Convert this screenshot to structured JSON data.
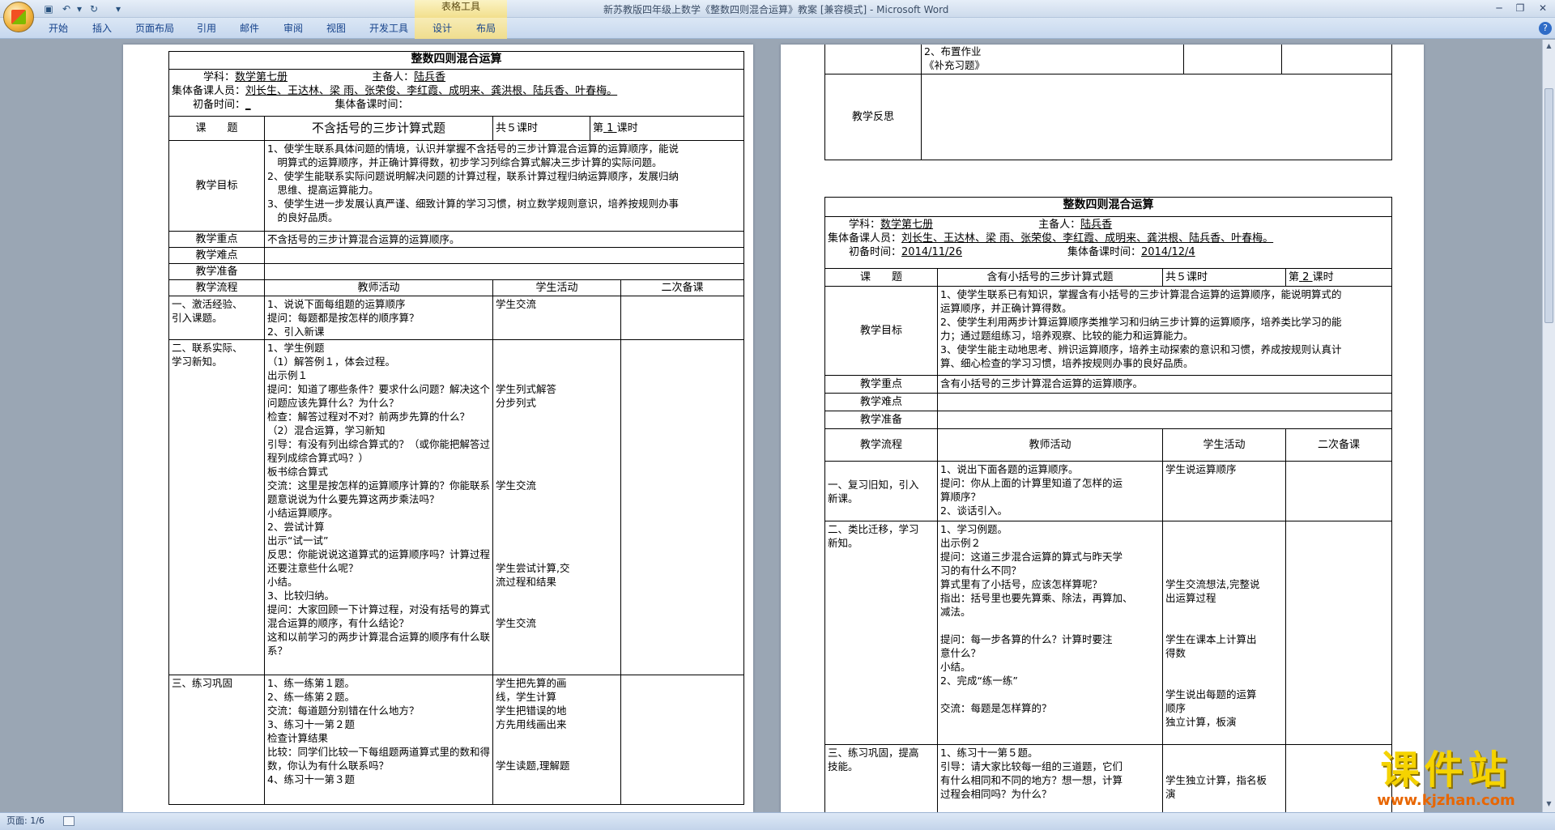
{
  "window": {
    "title": "新苏教版四年级上数学《整数四则混合运算》教案 [兼容模式] - Microsoft Word",
    "context_group": "表格工具"
  },
  "ribbon": {
    "tabs": [
      "开始",
      "插入",
      "页面布局",
      "引用",
      "邮件",
      "审阅",
      "视图",
      "开发工具",
      "设计",
      "布局"
    ]
  },
  "status": {
    "page": "页面: 1/6"
  },
  "left_page": {
    "title": "整数四则混合运算",
    "subject_label": "学科：",
    "subject": "数学第七册",
    "preparer_label": "主备人：",
    "preparer": "陆兵香",
    "members_label": "集体备课人员：",
    "members": "刘长生、王达林、梁 雨、张荣俊、李红霞、成明来、龚洪根、陆兵香、叶春梅。",
    "prep_time_label": "初备时间：",
    "prep_time": "_",
    "group_time_label": "集体备课时间：",
    "topic_label": "课　　题",
    "topic": "不含括号的三步计算式题",
    "total_hours": "共５课时",
    "nth_prefix": "第",
    "nth_value": "1",
    "nth_suffix": "课时",
    "goals_label": "教学目标",
    "goals": [
      "1、使学生联系具体问题的情境，认识并掌握不含括号的三步计算混合运算的运算顺序，能说",
      "　明算式的运算顺序，并正确计算得数，初步学习列综合算式解决三步计算的实际问题。",
      "2、使学生能联系实际问题说明解决问题的计算过程，联系计算过程归纳运算顺序，发展归纳",
      "　思维、提高运算能力。",
      "3、使学生进一步发展认真严谨、细致计算的学习习惯，树立数学规则意识，培养按规则办事",
      "　的良好品质。"
    ],
    "key_label": "教学重点",
    "key": "不含括号的三步计算混合运算的运算顺序。",
    "difficulty_label": "教学难点",
    "prep_label": "教学准备",
    "flow_head": [
      "教学流程",
      "教师活动",
      "学生活动",
      "二次备课"
    ],
    "sections": [
      {
        "name": [
          "一、激活经验、",
          "引入课题。"
        ],
        "teacher": [
          "1、说说下面每组题的运算顺序",
          "提问：每题都是按怎样的顺序算？",
          "2、引入新课"
        ],
        "student": [
          "学生交流"
        ]
      },
      {
        "name": [
          "二、联系实际、",
          "学习新知。"
        ],
        "teacher": [
          "1、学生例题",
          "（1）解答例１，体会过程。",
          "出示例１",
          "提问：知道了哪些条件？要求什么问题？解决这个",
          "问题应该先算什么？为什么？",
          "检查：解答过程对不对？前两步先算的什么？",
          "（2）混合运算，学习新知",
          "引导：有没有列出综合算式的？（或你能把解答过",
          "程列成综合算式吗？）",
          "板书综合算式",
          "交流：这里是按怎样的运算顺序计算的？你能联系",
          "题意说说为什么要先算这两步乘法吗？",
          "小结运算顺序。",
          "2、尝试计算",
          "出示“试一试”",
          "反思：你能说说这道算式的运算顺序吗？计算过程",
          "还要注意些什么呢？",
          "小结。",
          "3、比较归纳。",
          "提问：大家回顾一下计算过程，对没有括号的算式",
          "混合运算的顺序，有什么结论？",
          "这和以前学习的两步计算混合运算的顺序有什么联",
          "系？"
        ],
        "student": [
          "",
          "",
          "",
          "学生列式解答",
          "分步列式",
          "",
          "",
          "",
          "",
          "",
          "学生交流",
          "",
          "",
          "",
          "",
          "",
          "学生尝试计算,交",
          "流过程和结果",
          "",
          "",
          "学生交流"
        ]
      },
      {
        "name": [
          "三、练习巩固"
        ],
        "teacher": [
          "1、练一练第１题。",
          "2、练一练第２题。",
          "交流：每道题分别错在什么地方？",
          "3、练习十一第２题",
          "检查计算结果",
          "比较：同学们比较一下每组题两道算式里的数和得",
          "数，你认为有什么联系吗？",
          "4、练习十一第３题"
        ],
        "student": [
          "学生把先算的画",
          "线，学生计算",
          "学生把错误的地",
          "方先用线画出来",
          "",
          "",
          "学生读题,理解题"
        ]
      }
    ]
  },
  "right_page": {
    "cont_rows": [
      [
        "2、布置作业",
        "《补充习题》"
      ]
    ],
    "reflection_label": "教学反思",
    "title": "整数四则混合运算",
    "subject_label": "学科：",
    "subject": "数学第七册",
    "preparer_label": "主备人：",
    "preparer": "陆兵香",
    "members_label": "集体备课人员：",
    "members": "刘长生、王达林、梁 雨、张荣俊、李红霞、成明来、龚洪根、陆兵香、叶春梅。",
    "prep_time_label": "初备时间：",
    "prep_time": "2014/11/26",
    "group_time_label": "集体备课时间：",
    "group_time": "2014/12/4",
    "topic_label": "课　　题",
    "topic": "含有小括号的三步计算式题",
    "total_hours": "共５课时",
    "nth_prefix": "第",
    "nth_value": "2",
    "nth_suffix": "课时",
    "goals_label": "教学目标",
    "goals": [
      "1、使学生联系已有知识，掌握含有小括号的三步计算混合运算的运算顺序，能说明算式的",
      "运算顺序，并正确计算得数。",
      "2、使学生利用两步计算运算顺序类推学习和归纳三步计算的运算顺序，培养类比学习的能",
      "力；通过题组练习，培养观察、比较的能力和运算能力。",
      "3、使学生能主动地思考、辨识运算顺序，培养主动探索的意识和习惯，养成按规则认真计",
      "算、细心检查的学习习惯，培养按规则办事的良好品质。"
    ],
    "key_label": "教学重点",
    "key": "含有小括号的三步计算混合运算的运算顺序。",
    "difficulty_label": "教学难点",
    "prep_label": "教学准备",
    "flow_head": [
      "教学流程",
      "教师活动",
      "学生活动",
      "二次备课"
    ],
    "sections": [
      {
        "name": [
          "一、复习旧知，引入",
          "新课。"
        ],
        "teacher": [
          "1、说出下面各题的运算顺序。",
          "提问：你从上面的计算里知道了怎样的运",
          "算顺序？",
          "2、谈话引入。"
        ],
        "student": [
          "学生说运算顺序"
        ]
      },
      {
        "name": [
          "二、类比迁移，学习",
          "新知。"
        ],
        "teacher": [
          "1、学习例题。",
          "出示例２",
          "提问：这道三步混合运算的算式与昨天学",
          "习的有什么不同？",
          "算式里有了小括号，应该怎样算呢？",
          "指出：括号里也要先算乘、除法，再算加、",
          "减法。",
          "",
          "提问：每一步各算的什么？计算时要注",
          "意什么？",
          "小结。",
          "2、完成“练一练”",
          "",
          "交流：每题是怎样算的？"
        ],
        "student": [
          "",
          "",
          "",
          "",
          "学生交流想法,完整说",
          "出运算过程",
          "",
          "",
          "学生在课本上计算出",
          "得数",
          "",
          "",
          "学生说出每题的运算",
          "顺序",
          "独立计算，板演"
        ]
      },
      {
        "name": [
          "三、练习巩固，提高",
          "技能。"
        ],
        "teacher": [
          "1、练习十一第５题。",
          "引导：请大家比较每一组的三道题，它们",
          "有什么相同和不同的地方？想一想，计算",
          "过程会相同吗？为什么？"
        ],
        "student": [
          "",
          "",
          "学生独立计算，指名板",
          "演"
        ]
      }
    ]
  },
  "watermark": {
    "text": "课件站",
    "url": "www.kjzhan.com"
  }
}
